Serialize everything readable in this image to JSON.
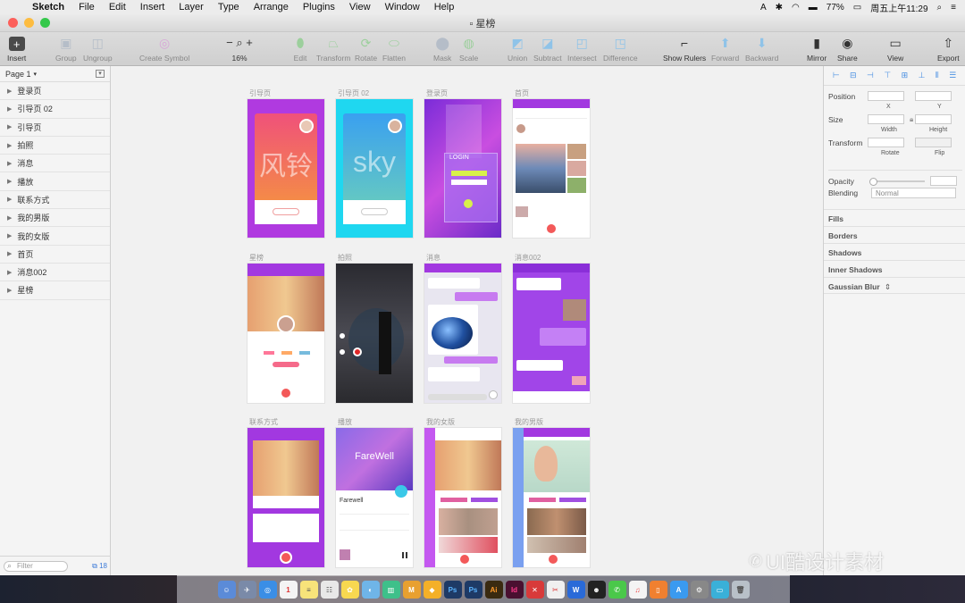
{
  "menubar": {
    "app_name": "Sketch",
    "items": [
      "File",
      "Edit",
      "Insert",
      "Layer",
      "Type",
      "Arrange",
      "Plugins",
      "View",
      "Window",
      "Help"
    ],
    "battery": "77%",
    "clock": "周五上午11:29"
  },
  "window": {
    "title": "星榜"
  },
  "toolbar": {
    "insert": "Insert",
    "group": "Group",
    "ungroup": "Ungroup",
    "create_symbol": "Create Symbol",
    "zoom": "16%",
    "edit": "Edit",
    "transform": "Transform",
    "rotate": "Rotate",
    "flatten": "Flatten",
    "mask": "Mask",
    "scale": "Scale",
    "union": "Union",
    "subtract": "Subtract",
    "intersect": "Intersect",
    "difference": "Difference",
    "show_rulers": "Show Rulers",
    "forward": "Forward",
    "backward": "Backward",
    "mirror": "Mirror",
    "share": "Share",
    "view": "View",
    "export": "Export"
  },
  "left_panel": {
    "page": "Page 1",
    "artboards": [
      "登录页",
      "引导页 02",
      "引导页",
      "拍照",
      "消息",
      "播放",
      "联系方式",
      "我的男版",
      "我的女版",
      "首页",
      "消息002",
      "星榜"
    ],
    "filter_placeholder": "Filter",
    "count": "18"
  },
  "canvas": {
    "labels": {
      "r1c1": "引导页",
      "r1c2": "引导页 02",
      "r1c3": "登录页",
      "r1c4": "首页",
      "r2c1": "星榜",
      "r2c2": "拍照",
      "r2c3": "消息",
      "r2c4": "消息002",
      "r3c1": "联系方式",
      "r3c2": "播放",
      "r3c3": "我的女版",
      "r3c4": "我的男版"
    },
    "text": {
      "fengling": "风铃",
      "sky": "sky",
      "login": "LOGIN",
      "farewell_hero": "FareWell",
      "farewell_title": "Farewell"
    }
  },
  "inspector": {
    "position": "Position",
    "x": "X",
    "y": "Y",
    "size": "Size",
    "width": "Width",
    "height": "Height",
    "transform": "Transform",
    "rotate": "Rotate",
    "flip": "Flip",
    "opacity": "Opacity",
    "blending": "Blending",
    "blending_value": "Normal",
    "fills": "Fills",
    "borders": "Borders",
    "shadows": "Shadows",
    "inner_shadows": "Inner Shadows",
    "gaussian_blur": "Gaussian Blur"
  },
  "watermark": "UI酷设计素材"
}
